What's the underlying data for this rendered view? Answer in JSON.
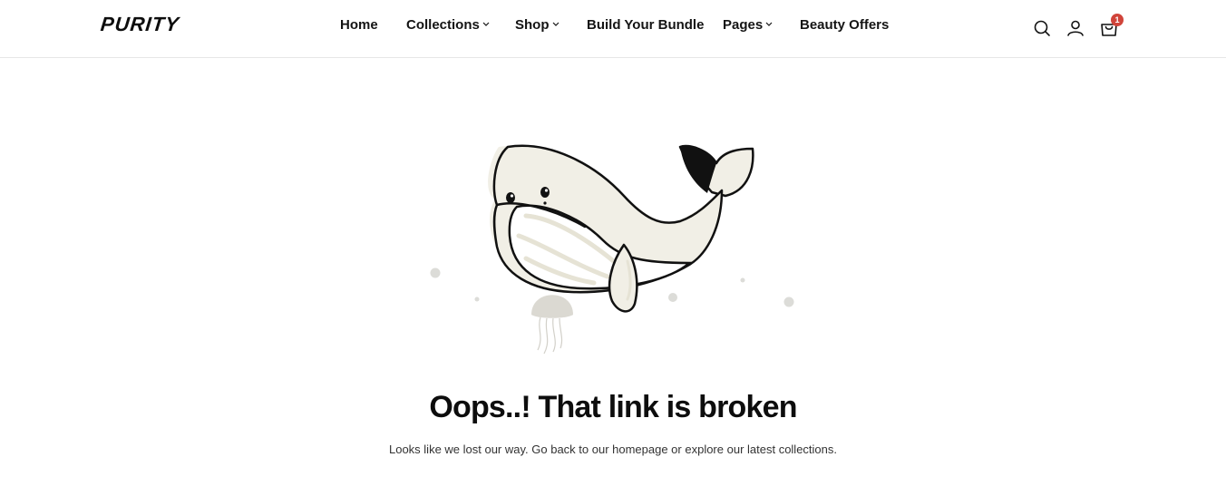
{
  "header": {
    "logo": "PURITY",
    "nav": [
      {
        "label": "Home",
        "has_dropdown": false
      },
      {
        "label": "Collections",
        "has_dropdown": true
      },
      {
        "label": "Shop",
        "has_dropdown": true
      },
      {
        "label": "Build Your Bundle",
        "has_dropdown": false
      },
      {
        "label": "Pages",
        "has_dropdown": true
      },
      {
        "label": "Beauty Offers",
        "has_dropdown": false
      }
    ],
    "icons": {
      "search": "search-icon",
      "account": "user-icon",
      "cart": "cart-icon"
    },
    "cart_count": "1",
    "badge_color": "#d0443a"
  },
  "error": {
    "title": "Oops..! That link is broken",
    "message": "Looks like we lost our way. Go back to our homepage or explore our latest collections."
  },
  "colors": {
    "whale_body": "#f1efe6",
    "outline": "#111111",
    "bubble": "#dcdcd8",
    "jellyfish": "#d8d6d0"
  }
}
